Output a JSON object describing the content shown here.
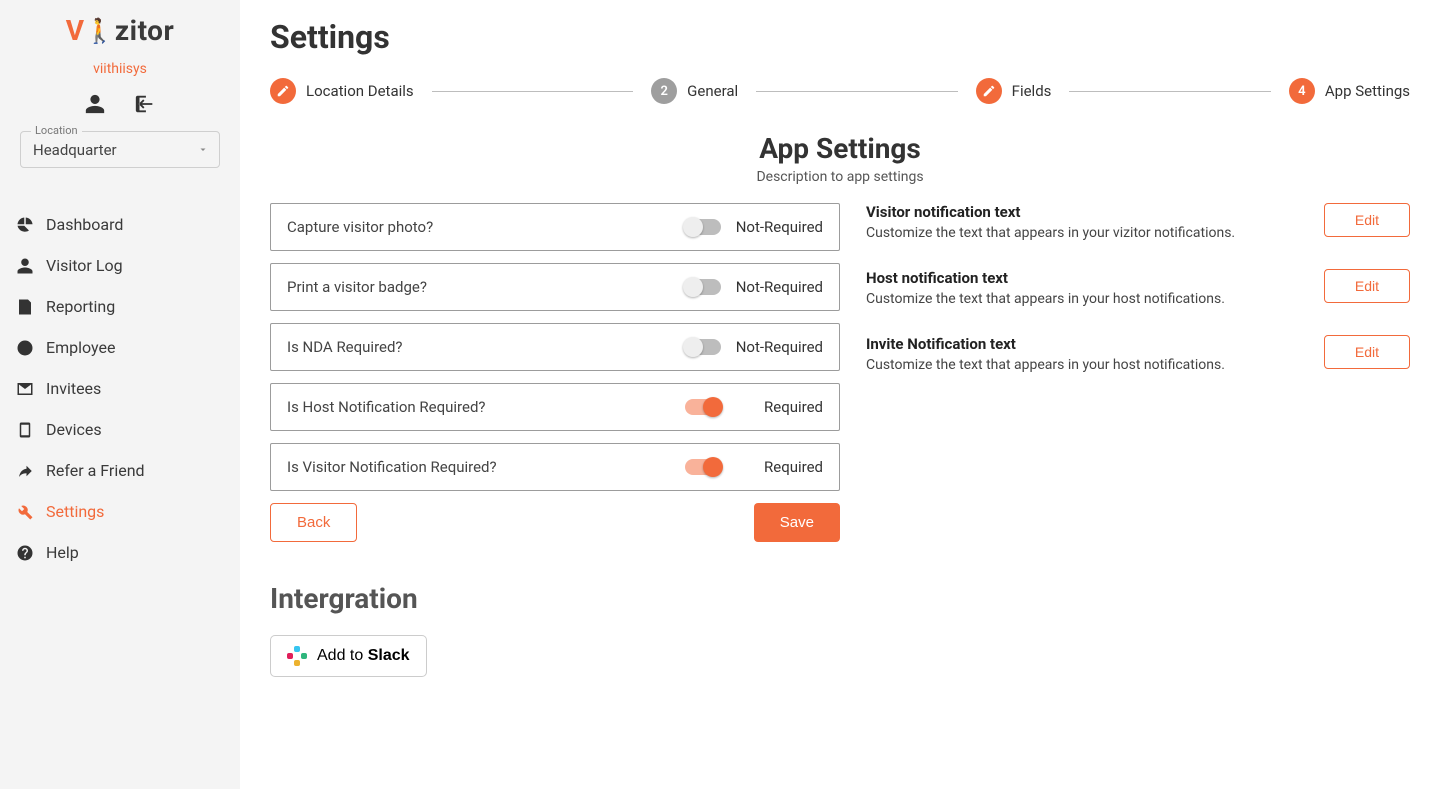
{
  "brand": {
    "pre": "V",
    "post": "zitor"
  },
  "org_name": "viithiisys",
  "location": {
    "label": "Location",
    "value": "Headquarter"
  },
  "nav": {
    "items": [
      {
        "label": "Dashboard"
      },
      {
        "label": "Visitor Log"
      },
      {
        "label": "Reporting"
      },
      {
        "label": "Employee"
      },
      {
        "label": "Invitees"
      },
      {
        "label": "Devices"
      },
      {
        "label": "Refer a Friend"
      },
      {
        "label": "Settings"
      },
      {
        "label": "Help"
      }
    ]
  },
  "page_title": "Settings",
  "stepper": {
    "steps": [
      {
        "label": "Location Details",
        "badge": "pencil",
        "color": "orange"
      },
      {
        "label": "General",
        "badge": "2",
        "color": "grey"
      },
      {
        "label": "Fields",
        "badge": "pencil",
        "color": "orange"
      },
      {
        "label": "App Settings",
        "badge": "4",
        "color": "orange"
      }
    ]
  },
  "section": {
    "title": "App Settings",
    "description": "Description to app settings"
  },
  "toggles": [
    {
      "label": "Capture visitor photo?",
      "state": "Not-Required",
      "on": false
    },
    {
      "label": "Print a visitor badge?",
      "state": "Not-Required",
      "on": false
    },
    {
      "label": "Is NDA Required?",
      "state": "Not-Required",
      "on": false
    },
    {
      "label": "Is Host Notification Required?",
      "state": "Required",
      "on": true
    },
    {
      "label": "Is Visitor Notification Required?",
      "state": "Required",
      "on": true
    }
  ],
  "actions": {
    "back": "Back",
    "save": "Save"
  },
  "notifications": [
    {
      "title": "Visitor notification text",
      "desc": "Customize the text that appears in your vizitor notifications.",
      "edit": "Edit"
    },
    {
      "title": "Host notification text",
      "desc": "Customize the text that appears in your host notifications.",
      "edit": "Edit"
    },
    {
      "title": "Invite Notification text",
      "desc": "Customize the text that appears in your host notifications.",
      "edit": "Edit"
    }
  ],
  "integration": {
    "heading": "Intergration",
    "slack_pre": "Add to ",
    "slack_bold": "Slack"
  }
}
